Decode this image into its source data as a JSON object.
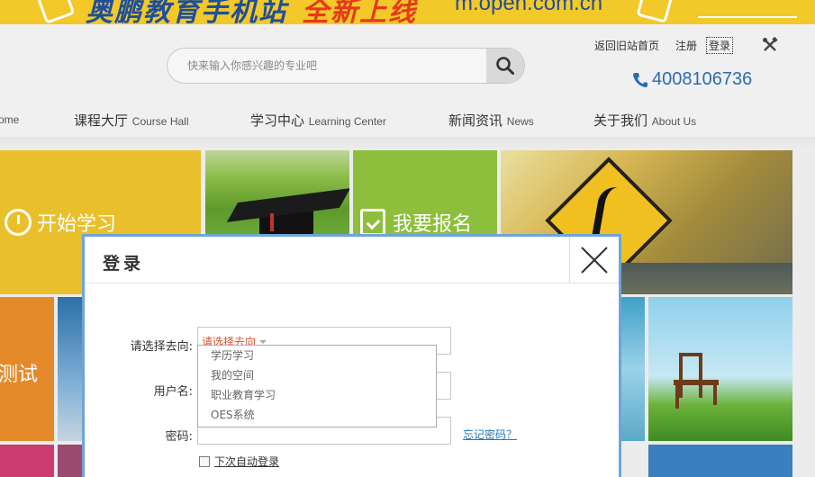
{
  "banner": {
    "brand_text": "奥鹏教育手机站",
    "accent_text": "全新上线",
    "url_text": "m.open.com.cn"
  },
  "header": {
    "search": {
      "placeholder": "快来输入你感兴趣的专业吧"
    },
    "top_links": {
      "old_home": "返回旧站首页",
      "register": "注册",
      "login": "登录"
    },
    "phone": "4008106736",
    "nav": [
      {
        "cn": "",
        "en": "ome"
      },
      {
        "cn": "课程大厅",
        "en": "Course Hall"
      },
      {
        "cn": "学习中心",
        "en": "Learning Center"
      },
      {
        "cn": "新闻资讯",
        "en": "News"
      },
      {
        "cn": "关于我们",
        "en": "About Us"
      }
    ]
  },
  "tiles": {
    "start_learning": "开始学习",
    "enroll": "我要报名",
    "test": "测试"
  },
  "login_modal": {
    "title": "登录",
    "direction_label": "请选择去向:",
    "direction_selected": "请选择去向",
    "direction_options": [
      "学历学习",
      "我的空间",
      "职业教育学习",
      "OES系统"
    ],
    "username_label": "用户名:",
    "password_label": "密码:",
    "forgot_password": "忘记密码？",
    "remember_me": "下次自动登录"
  },
  "colors": {
    "accent_blue": "#2a6cb3",
    "modal_border": "#6ea5d8",
    "select_text": "#d9532f",
    "banner_yellow": "#f3c829"
  }
}
